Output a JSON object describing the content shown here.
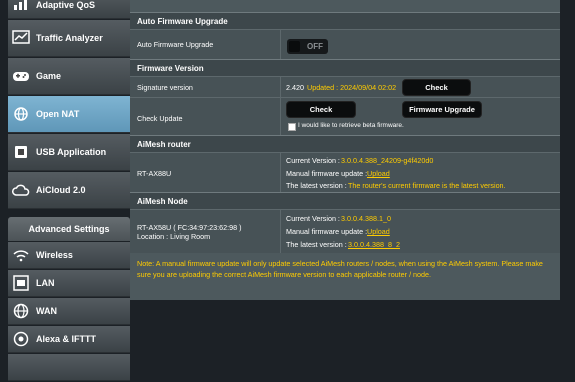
{
  "sidebar": {
    "items_top": [
      {
        "label": "Adaptive QoS",
        "icon": "adaptive-qos-icon"
      },
      {
        "label": "Traffic Analyzer",
        "icon": "traffic-analyzer-icon"
      },
      {
        "label": "Game",
        "icon": "game-icon"
      },
      {
        "label": "Open NAT",
        "icon": "open-nat-icon",
        "active": true
      },
      {
        "label": "USB Application",
        "icon": "usb-icon"
      },
      {
        "label": "AiCloud 2.0",
        "icon": "aicloud-icon"
      }
    ],
    "advanced_heading": "Advanced Settings",
    "items_advanced": [
      {
        "label": "Wireless",
        "icon": "wireless-icon"
      },
      {
        "label": "LAN",
        "icon": "lan-icon"
      },
      {
        "label": "WAN",
        "icon": "wan-icon"
      },
      {
        "label": "Alexa & IFTTT",
        "icon": "alexa-icon"
      }
    ]
  },
  "auto_upgrade": {
    "heading": "Auto Firmware Upgrade",
    "label": "Auto Firmware Upgrade",
    "toggle_text": "OFF"
  },
  "firmware": {
    "heading": "Firmware Version",
    "signature_label": "Signature version",
    "signature_version": "2.420",
    "signature_updated": "Updated : 2024/09/04 02:02",
    "check_button": "Check",
    "check_update_label": "Check Update",
    "check_update_button": "Check",
    "firmware_upgrade_button": "Firmware Upgrade",
    "beta_label": "I would like to retrieve beta firmware."
  },
  "aimesh_router": {
    "heading": "AiMesh router",
    "model": "RT-AX88U",
    "current_label": "Current Version :",
    "current_value": "3.0.0.4.388_24209-g4f420d0",
    "manual_label": "Manual firmware update :",
    "manual_link": "Upload",
    "latest_label": "The latest version :",
    "latest_value": "The router's current firmware is the latest version."
  },
  "aimesh_node": {
    "heading": "AiMesh Node",
    "model": "RT-AX58U ( FC:34:97:23:62:98 )",
    "location": "Location : Living Room",
    "current_label": "Current Version :",
    "current_value": "3.0.0.4.388.1_0",
    "manual_label": "Manual firmware update :",
    "manual_link": "Upload",
    "latest_label": "The latest version :",
    "latest_value": "3.0.0.4.388_8_2"
  },
  "note": "Note: A manual firmware update will only update selected AiMesh routers / nodes, when using the AiMesh system. Please make sure you are uploading the correct AiMesh firmware version to each applicable router / node."
}
